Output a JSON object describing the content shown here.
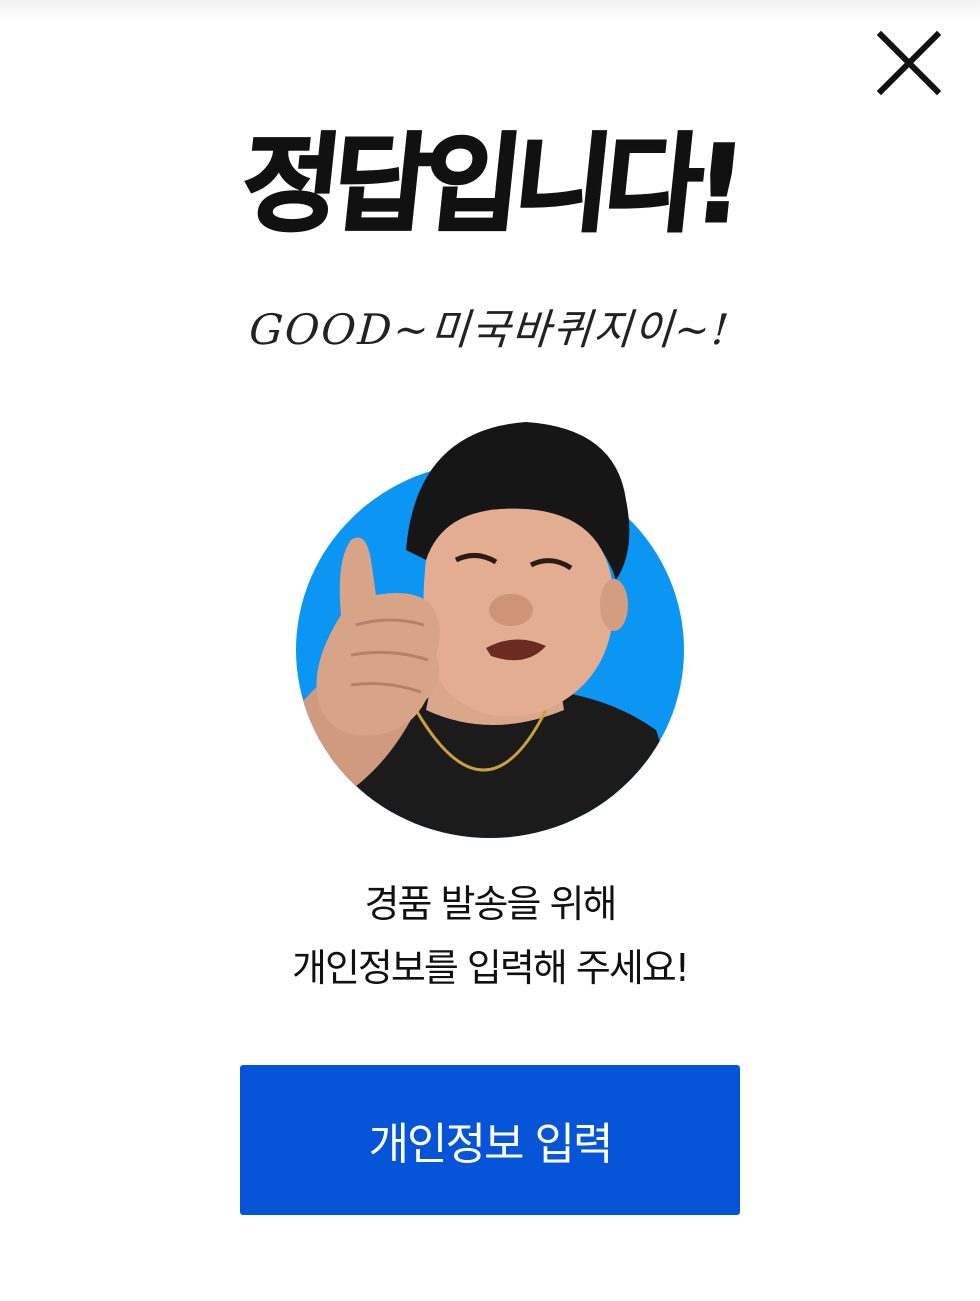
{
  "modal": {
    "title": "정답입니다!",
    "subtitle": "GOOD~미국바퀴지이~!",
    "message_line1": "경품 발송을 위해",
    "message_line2": "개인정보를 입력해 주세요!",
    "cta_label": "개인정보 입력"
  },
  "icons": {
    "close": "close-icon"
  },
  "colors": {
    "accent_blue": "#0655d8",
    "avatar_bg": "#0a96f2",
    "text": "#111111"
  }
}
